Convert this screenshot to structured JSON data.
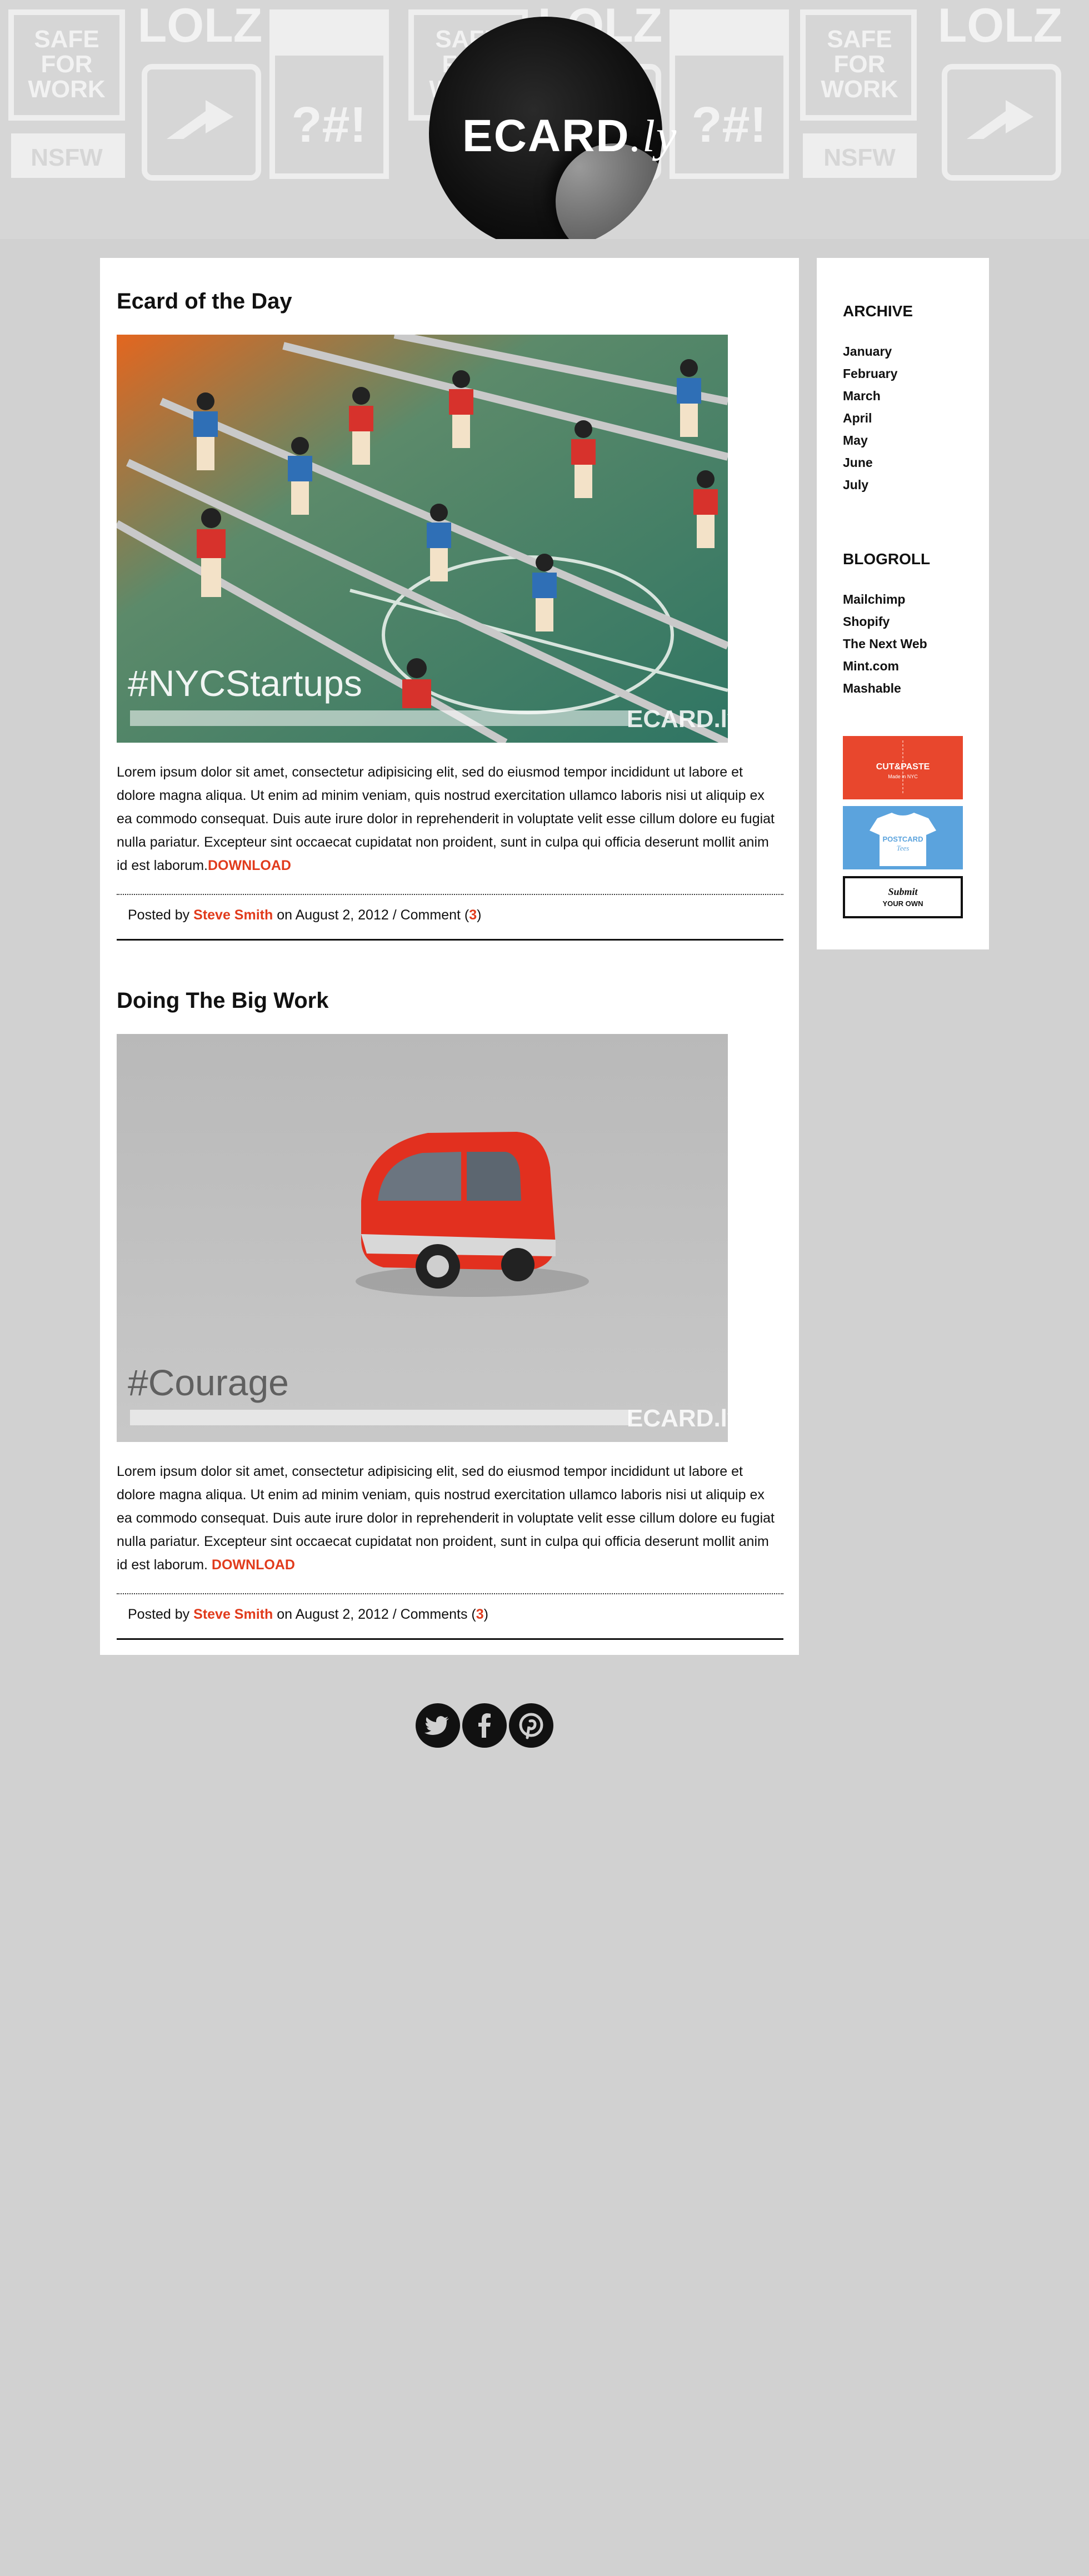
{
  "site": {
    "logo_main": "ECARD",
    "logo_suffix": ".ly",
    "pattern_words": [
      "SAFE",
      "FOR",
      "WORK",
      "LOLZ",
      "NSFW",
      "?#!"
    ]
  },
  "posts": [
    {
      "title": "Ecard of the Day",
      "image_caption": "#NYCStartups",
      "image_brand": "ECARD.ly",
      "body": "Lorem ipsum dolor sit amet, consectetur adipisicing elit, sed do eiusmod tempor incididunt ut labore et dolore magna aliqua. Ut enim ad minim veniam, quis nostrud exercitation ullamco laboris nisi ut aliquip ex ea commodo consequat. Duis aute irure dolor in reprehenderit in voluptate velit esse cillum dolore eu fugiat nulla pariatur. Excepteur sint occaecat cupidatat non proident, sunt in culpa qui officia deserunt mollit anim id est laborum.",
      "download_label": "DOWNLOAD",
      "posted_by_prefix": "Posted by",
      "author": "Steve Smith",
      "date_text": "on August 2, 2012 / Comment (",
      "comment_count": "3",
      "close_paren": ")"
    },
    {
      "title": "Doing The Big Work",
      "image_caption": "#Courage",
      "image_brand": "ECARD.ly",
      "body": "Lorem ipsum dolor sit amet, consectetur adipisicing elit, sed do eiusmod tempor incididunt ut labore et dolore magna aliqua. Ut enim ad minim veniam, quis nostrud exercitation ullamco laboris nisi ut aliquip ex ea commodo consequat. Duis aute irure dolor in reprehenderit in voluptate velit esse cillum dolore eu fugiat nulla pariatur. Excepteur sint occaecat cupidatat non proident, sunt in culpa qui officia deserunt mollit anim id est laborum.",
      "download_label": "DOWNLOAD",
      "posted_by_prefix": "Posted by",
      "author": "Steve Smith",
      "date_text": "on August 2, 2012 / Comments (",
      "comment_count": "3",
      "close_paren": ")"
    }
  ],
  "sidebar": {
    "archive_heading": "ARCHIVE",
    "archive_items": [
      "January",
      "February",
      "March",
      "April",
      "May",
      "June",
      "July"
    ],
    "blogroll_heading": "BLOGROLL",
    "blogroll_items": [
      "Mailchimp",
      "Shopify",
      "The Next Web",
      "Mint.com",
      "Mashable"
    ],
    "banners": [
      {
        "name": "CUT&PASTE",
        "sub": "Made in NYC",
        "color": "#e8472d"
      },
      {
        "name": "POSTCARD",
        "sub": "Tees",
        "color": "#5ba3dd"
      },
      {
        "name": "Submit",
        "sub": "YOUR OWN",
        "color": "#ffffff"
      }
    ]
  },
  "social": {
    "icons": [
      "twitter-icon",
      "facebook-icon",
      "pinterest-icon"
    ],
    "background": "#111111"
  },
  "colors": {
    "page_bg": "#d1d1d1",
    "accent": "#e13b1c",
    "text": "#111111"
  }
}
